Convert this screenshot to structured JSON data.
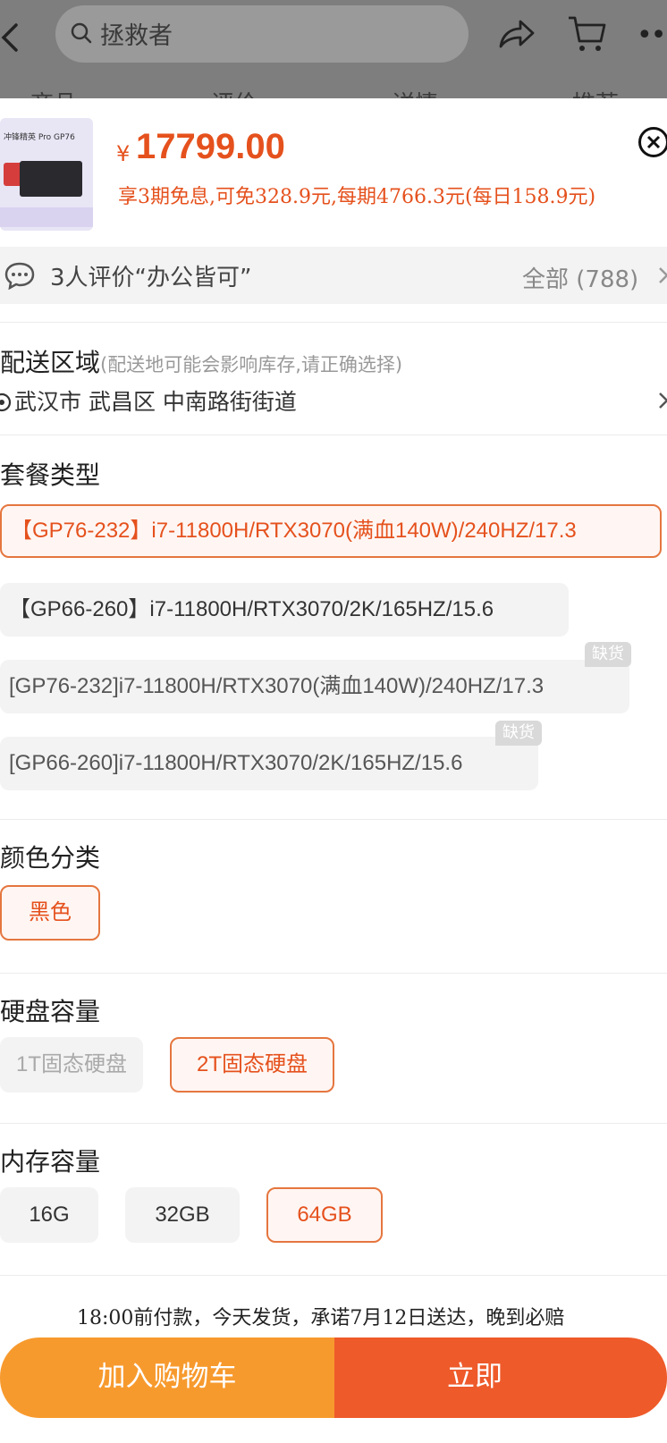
{
  "header": {
    "search_placeholder": "拯救者",
    "tabs": [
      "商品",
      "评价",
      "详情",
      "推荐"
    ]
  },
  "product": {
    "thumb_title": "冲锋精英 Pro GP76",
    "currency": "¥",
    "price": "17799.00",
    "installment": "享3期免息,可免328.9元,每期4766.3元(每日158.9元)"
  },
  "review": {
    "text": "3人评价“办公皆可”",
    "all_label": "全部 (788)"
  },
  "delivery_area": {
    "title": "配送区域",
    "subtitle": "(配送地可能会影响库存,请正确选择)",
    "address": "武汉市 武昌区 中南路街街道"
  },
  "package": {
    "title": "套餐类型",
    "out_of_stock_label": "缺货",
    "options": [
      {
        "label": "【GP76-232】i7-11800H/RTX3070(满血140W)/240HZ/17.3",
        "selected": true
      },
      {
        "label": "【GP66-260】i7-11800H/RTX3070/2K/165HZ/15.6",
        "selected": false
      },
      {
        "label": "[GP76-232]i7-11800H/RTX3070(满血140W)/240HZ/17.3",
        "selected": false,
        "out_of_stock": true
      },
      {
        "label": "[GP66-260]i7-11800H/RTX3070/2K/165HZ/15.6",
        "selected": false,
        "out_of_stock": true
      }
    ]
  },
  "color": {
    "title": "颜色分类",
    "options": [
      {
        "label": "黑色",
        "selected": true
      }
    ]
  },
  "storage": {
    "title": "硬盘容量",
    "options": [
      {
        "label": "1T固态硬盘",
        "selected": false,
        "disabled": true
      },
      {
        "label": "2T固态硬盘",
        "selected": true
      }
    ]
  },
  "memory": {
    "title": "内存容量",
    "options": [
      {
        "label": "16G",
        "selected": false
      },
      {
        "label": "32GB",
        "selected": false
      },
      {
        "label": "64GB",
        "selected": true
      }
    ]
  },
  "delivery_note": "18:00前付款，今天发货，承诺7月12日送达，晚到必赔",
  "actions": {
    "add_to_cart": "加入购物车",
    "buy_now": "立即"
  },
  "colors": {
    "accent": "#e5511d",
    "cart_button": "#f79a2e",
    "buy_button": "#ee5a2a"
  }
}
